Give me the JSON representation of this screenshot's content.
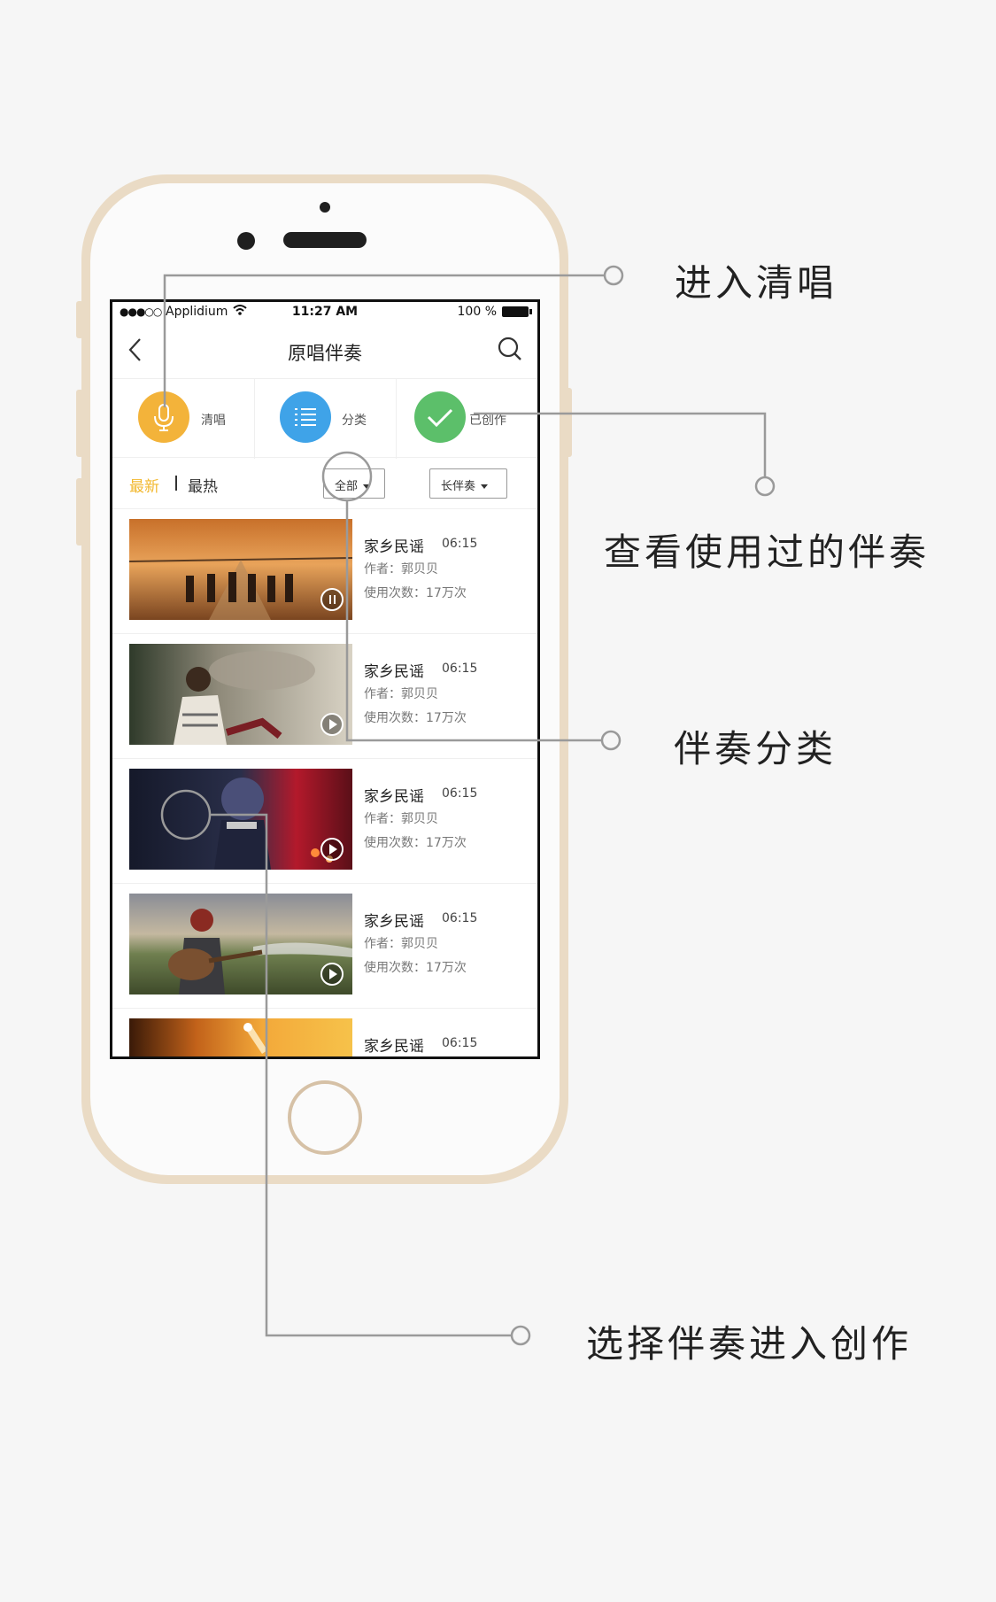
{
  "status_bar": {
    "signal": "●●●○○",
    "carrier": "Applidium",
    "time": "11:27 AM",
    "battery": "100 %"
  },
  "nav": {
    "title": "原唱伴奏",
    "back_icon": "chevron-left-icon",
    "search_icon": "search-icon"
  },
  "shortcuts": [
    {
      "label": "清唱",
      "icon": "microphone-icon",
      "color": "#f3b33a"
    },
    {
      "label": "分类",
      "icon": "list-icon",
      "color": "#3fa3e8"
    },
    {
      "label": "已创作",
      "icon": "check-icon",
      "color": "#5cbf6a"
    }
  ],
  "filters": {
    "tab_new": "最新",
    "tab_hot": "最热",
    "category_dropdown": "全部",
    "type_dropdown": "长伴奏",
    "active_color": "#f2b82f"
  },
  "songs": [
    {
      "title": "家乡民谣",
      "duration": "06:15",
      "author": "作者：郭贝贝",
      "uses": "使用次数：17万次",
      "state": "playing"
    },
    {
      "title": "家乡民谣",
      "duration": "06:15",
      "author": "作者：郭贝贝",
      "uses": "使用次数：17万次",
      "state": "paused"
    },
    {
      "title": "家乡民谣",
      "duration": "06:15",
      "author": "作者：郭贝贝",
      "uses": "使用次数：17万次",
      "state": "paused"
    },
    {
      "title": "家乡民谣",
      "duration": "06:15",
      "author": "作者：郭贝贝",
      "uses": "使用次数：17万次",
      "state": "paused"
    },
    {
      "title": "家乡民谣",
      "duration": "06:15",
      "author": "",
      "uses": "",
      "state": "paused"
    }
  ],
  "annotations": {
    "enter_acapella": "进入清唱",
    "view_used": "查看使用过的伴奏",
    "categories": "伴奏分类",
    "select_to_create": "选择伴奏进入创作"
  }
}
